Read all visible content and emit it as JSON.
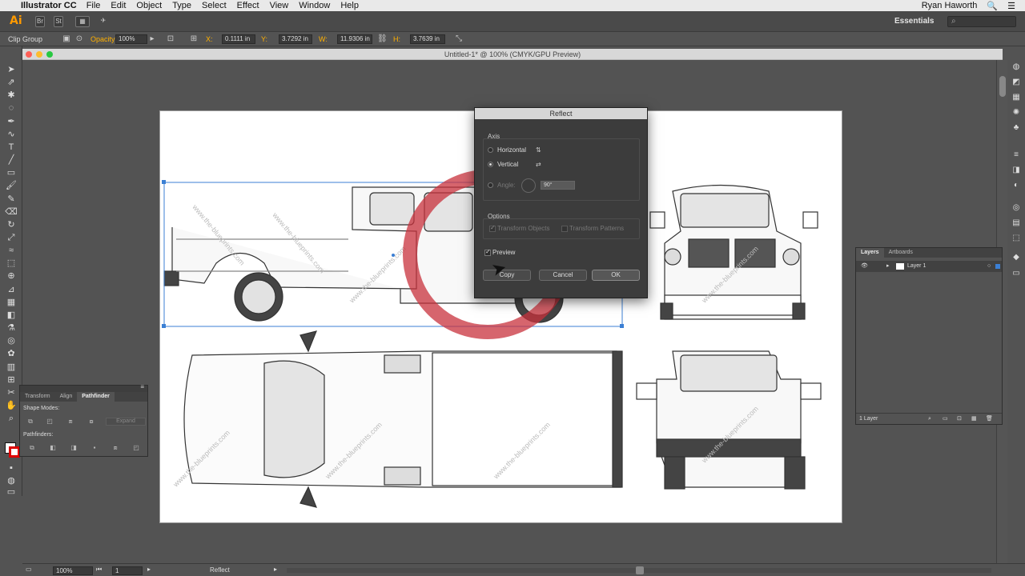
{
  "menubar": {
    "app_name": "Illustrator CC",
    "items": [
      "File",
      "Edit",
      "Object",
      "Type",
      "Select",
      "Effect",
      "View",
      "Window",
      "Help"
    ],
    "user": "Ryan Haworth"
  },
  "appbar": {
    "logo": "Ai",
    "workspace": "Essentials",
    "stock_search_placeholder": ""
  },
  "control": {
    "selection": "Clip Group",
    "opacity_label": "Opacity:",
    "opacity": "100%",
    "x_label": "X:",
    "x": "0.1111 in",
    "y_label": "Y:",
    "y": "3.7292 in",
    "w_label": "W:",
    "w": "11.9306 in",
    "h_label": "H:",
    "h": "3.7639 in"
  },
  "document": {
    "title": "Untitled-1* @ 100% (CMYK/GPU Preview)"
  },
  "reflect": {
    "title": "Reflect",
    "axis_label": "Axis",
    "horizontal": "Horizontal",
    "vertical": "Vertical",
    "angle_label": "Angle:",
    "angle_value": "90°",
    "options_label": "Options",
    "transform_objects": "Transform Objects",
    "transform_patterns": "Transform Patterns",
    "preview": "Preview",
    "copy_btn": "Copy",
    "cancel_btn": "Cancel",
    "ok_btn": "OK",
    "axis_selected": "vertical"
  },
  "pathfinder": {
    "tabs": [
      "Transform",
      "Align",
      "Pathfinder"
    ],
    "active_tab": "Pathfinder",
    "shape_modes_label": "Shape Modes:",
    "pathfinders_label": "Pathfinders:",
    "expand_label": "Expand"
  },
  "layers": {
    "tabs": [
      "Layers",
      "Artboards"
    ],
    "active_tab": "Layers",
    "layer_name": "Layer 1",
    "footer": "1 Layer"
  },
  "status": {
    "zoom": "100%",
    "page": "1",
    "tool_name": "Reflect"
  },
  "watermark": "www.the-blueprints.com",
  "colors": {
    "accent_orange": "#ff9a00",
    "click_ring": "#c8323c",
    "ui_dark": "#535353",
    "selection_blue": "#3b7fd4"
  }
}
